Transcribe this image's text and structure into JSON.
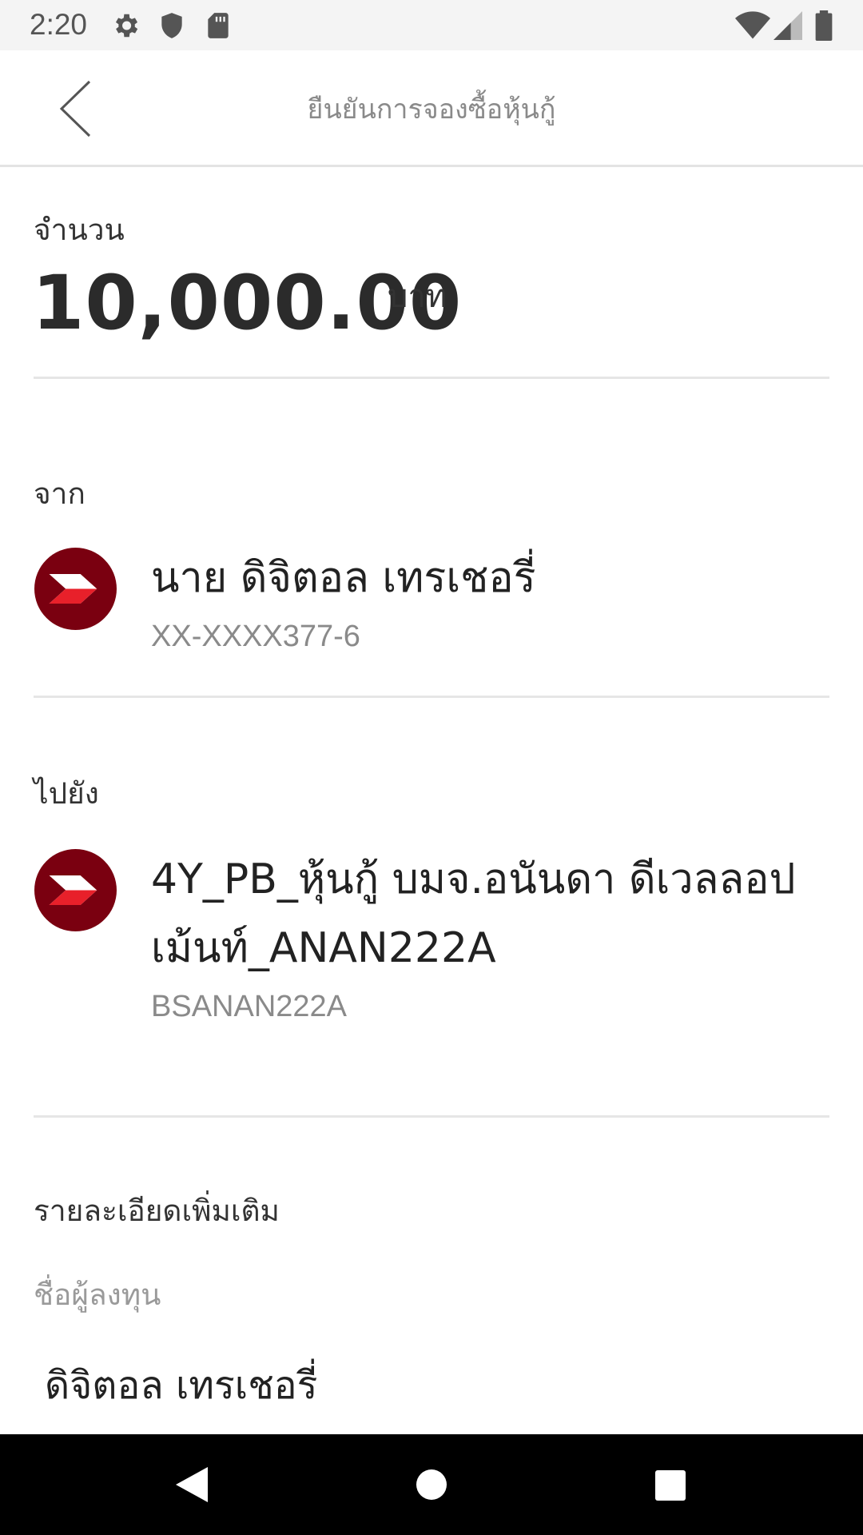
{
  "status_bar": {
    "time": "2:20",
    "left_icons": [
      "gear-icon",
      "shield-icon",
      "sd-card-icon"
    ],
    "right_icons": [
      "wifi-icon",
      "cell-signal-icon",
      "battery-icon"
    ]
  },
  "header": {
    "title": "ยืนยันการจองซื้อหุ้นกู้",
    "back_icon": "chevron-left-icon"
  },
  "amount": {
    "label": "จำนวน",
    "value": "10,000.00",
    "unit": "บาท"
  },
  "from": {
    "label": "จาก",
    "name": "นาย ดิจิตอล เทรเชอรี่",
    "account": "XX-XXXX377-6"
  },
  "to": {
    "label": "ไปยัง",
    "name": "4Y_PB_หุ้นกู้ บมจ.อนันดา ดีเวลลอปเม้นท์_ANAN222A",
    "account": "BSANAN222A"
  },
  "details": {
    "title": "รายละเอียดเพิ่มเติม",
    "investor_label": "ชื่อผู้ลงทุน",
    "investor_value": "ดิจิตอล เทรเชอรี่"
  },
  "colors": {
    "brand_dark_red": "#7a0010",
    "brand_red": "#e8202a",
    "divider": "#e6e6e6"
  },
  "nav_bar": {
    "icons": [
      "back-triangle-icon",
      "home-circle-icon",
      "recents-square-icon"
    ]
  }
}
